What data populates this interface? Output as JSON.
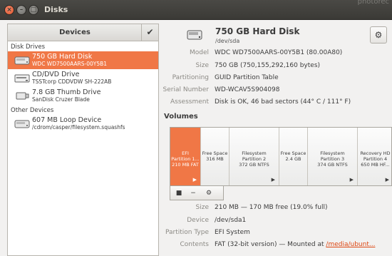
{
  "window": {
    "title": "Disks",
    "background_app": "photorec",
    "close": "×",
    "minimize": "–",
    "maximize": "□"
  },
  "sidebar": {
    "title": "Devices",
    "check": "✔",
    "disk_drives_label": "Disk Drives",
    "other_devices_label": "Other Devices",
    "drives": [
      {
        "name": "750 GB Hard Disk",
        "sub": "WDC WD7500AARS-00Y5B1",
        "icon": "hard-disk-icon"
      },
      {
        "name": "CD/DVD Drive",
        "sub": "TSSTcorp CDDVDW SH-222AB",
        "icon": "optical-drive-icon"
      },
      {
        "name": "7.8 GB Thumb Drive",
        "sub": "SanDisk Cruzer Blade",
        "icon": "usb-drive-icon"
      }
    ],
    "others": [
      {
        "name": "607 MB Loop Device",
        "sub": "/cdrom/casper/filesystem.squashfs",
        "icon": "loop-device-icon"
      }
    ]
  },
  "disk": {
    "name": "750 GB Hard Disk",
    "path": "/dev/sda",
    "gear": "⚙",
    "props": [
      {
        "key": "Model",
        "value": "WDC WD7500AARS-00Y5B1 (80.00A80)"
      },
      {
        "key": "Size",
        "value": "750 GB (750,155,292,160 bytes)"
      },
      {
        "key": "Partitioning",
        "value": "GUID Partition Table"
      },
      {
        "key": "Serial Number",
        "value": "WD-WCAV5S904098"
      },
      {
        "key": "Assessment",
        "value": "Disk is OK, 46 bad sectors (44° C / 111° F)"
      }
    ]
  },
  "volumes": {
    "title": "Volumes",
    "partitions": [
      {
        "l1": "EFI",
        "l2": "Partition 1...",
        "l3": "210 MB FAT",
        "arrow": "▶"
      },
      {
        "l1": "Free Space",
        "l2": "316 MB",
        "l3": "",
        "arrow": ""
      },
      {
        "l1": "Filesystem",
        "l2": "Partition 2",
        "l3": "372 GB NTFS",
        "arrow": "▶"
      },
      {
        "l1": "Free Space",
        "l2": "2.4 GB",
        "l3": "",
        "arrow": ""
      },
      {
        "l1": "Filesystem",
        "l2": "Partition 3",
        "l3": "374 GB NTFS",
        "arrow": "▶"
      },
      {
        "l1": "Recovery HD",
        "l2": "Partition 4",
        "l3": "650 MB HF...",
        "arrow": "▶"
      }
    ],
    "tools": {
      "stop": "■",
      "remove": "−",
      "settings": "⚙"
    }
  },
  "volume_details": [
    {
      "key": "Size",
      "value": "210 MB — 170 MB free (19.0% full)"
    },
    {
      "key": "Device",
      "value": "/dev/sda1"
    },
    {
      "key": "Partition Type",
      "value": "EFI System"
    },
    {
      "key": "Contents",
      "value": "FAT (32-bit version) — Mounted at ",
      "link": "/media/ubunt..."
    }
  ],
  "colors": {
    "accent": "#f07746",
    "link": "#dd4814",
    "titlebar": "#3b3a36"
  }
}
